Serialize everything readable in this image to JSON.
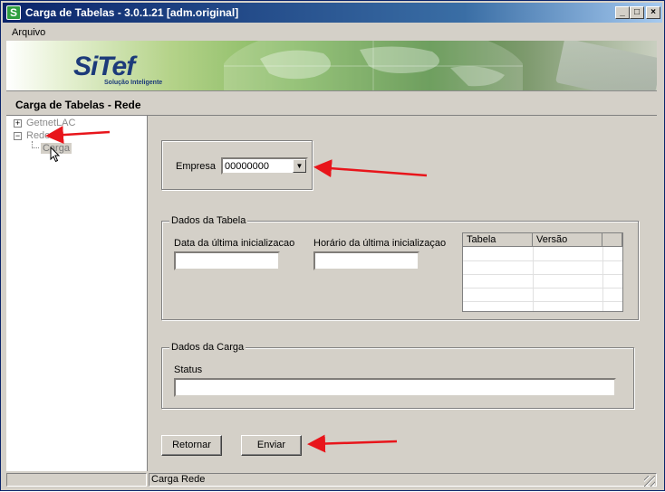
{
  "window": {
    "title": "Carga de Tabelas - 3.0.1.21  [adm.original]",
    "app_icon_letter": "S",
    "controls": {
      "minimize": "_",
      "maximize": "□",
      "close": "×"
    }
  },
  "menu": {
    "items": [
      "Arquivo"
    ]
  },
  "banner": {
    "logo": "SiTef",
    "tagline": "Solução Inteligente"
  },
  "section": {
    "title": "Carga de Tabelas - Rede"
  },
  "tree": {
    "nodes": [
      {
        "label": "GetnetLAC",
        "expander": "+"
      },
      {
        "label": "Rede",
        "expander": "−"
      },
      {
        "label": "Carga"
      }
    ]
  },
  "empresa": {
    "label": "Empresa",
    "value": "00000000"
  },
  "dados_tabela": {
    "legend": "Dados da Tabela",
    "data_label": "Data da última inicializacao",
    "horario_label": "Horário da última inicializaçao",
    "grid": {
      "columns": [
        "Tabela",
        "Versão",
        ""
      ]
    }
  },
  "dados_carga": {
    "legend": "Dados da Carga",
    "status_label": "Status"
  },
  "buttons": {
    "retornar": "Retornar",
    "enviar": "Enviar"
  },
  "statusbar": {
    "panel1": "",
    "panel2": "Carga Rede"
  },
  "colors": {
    "annotation_arrow": "#e8151b",
    "title_bar": "#0a246a",
    "face": "#d4d0c8"
  }
}
